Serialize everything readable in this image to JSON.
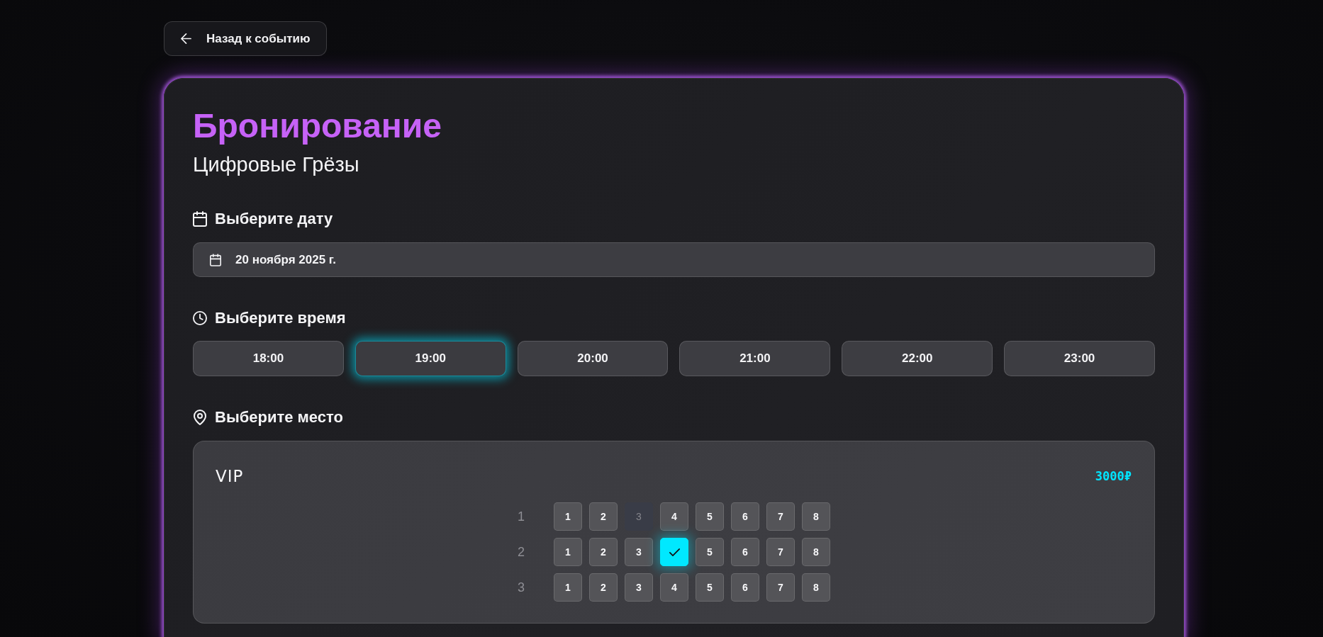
{
  "back_button": {
    "label": "Назад к событию"
  },
  "booking": {
    "title": "Бронирование",
    "subtitle": "Цифровые Грёзы"
  },
  "date_section": {
    "heading": "Выберите дату",
    "date_field": {
      "value": "20 ноября 2025 г."
    }
  },
  "time_section": {
    "heading": "Выберите время",
    "times": [
      {
        "label": "18:00",
        "selected": false
      },
      {
        "label": "19:00",
        "selected": true
      },
      {
        "label": "20:00",
        "selected": false
      },
      {
        "label": "21:00",
        "selected": false
      },
      {
        "label": "22:00",
        "selected": false
      },
      {
        "label": "23:00",
        "selected": false
      }
    ]
  },
  "seat_section": {
    "heading": "Выберите место",
    "zones": [
      {
        "name": "VIP",
        "price": "3000₽",
        "rows": [
          {
            "label": "1",
            "seats": [
              {
                "label": "1",
                "selected": false,
                "disabled": false
              },
              {
                "label": "2",
                "selected": false,
                "disabled": false
              },
              {
                "label": "3",
                "selected": false,
                "disabled": true
              },
              {
                "label": "4",
                "selected": false,
                "disabled": false
              },
              {
                "label": "5",
                "selected": false,
                "disabled": false
              },
              {
                "label": "6",
                "selected": false,
                "disabled": false
              },
              {
                "label": "7",
                "selected": false,
                "disabled": false
              },
              {
                "label": "8",
                "selected": false,
                "disabled": false
              }
            ]
          },
          {
            "label": "2",
            "seats": [
              {
                "label": "1",
                "selected": false,
                "disabled": false
              },
              {
                "label": "2",
                "selected": false,
                "disabled": false
              },
              {
                "label": "3",
                "selected": false,
                "disabled": false
              },
              {
                "selected": true,
                "disabled": false
              },
              {
                "label": "5",
                "selected": false,
                "disabled": false
              },
              {
                "label": "6",
                "selected": false,
                "disabled": false
              },
              {
                "label": "7",
                "selected": false,
                "disabled": false
              },
              {
                "label": "8",
                "selected": false,
                "disabled": false
              }
            ]
          },
          {
            "label": "3",
            "seats": [
              {
                "label": "1",
                "selected": false,
                "disabled": false
              },
              {
                "label": "2",
                "selected": false,
                "disabled": false
              },
              {
                "label": "3",
                "selected": false,
                "disabled": false
              },
              {
                "label": "4",
                "selected": false,
                "disabled": false
              },
              {
                "label": "5",
                "selected": false,
                "disabled": false
              },
              {
                "label": "6",
                "selected": false,
                "disabled": false
              },
              {
                "label": "7",
                "selected": false,
                "disabled": false
              },
              {
                "label": "8",
                "selected": false,
                "disabled": false
              }
            ]
          }
        ]
      }
    ]
  }
}
